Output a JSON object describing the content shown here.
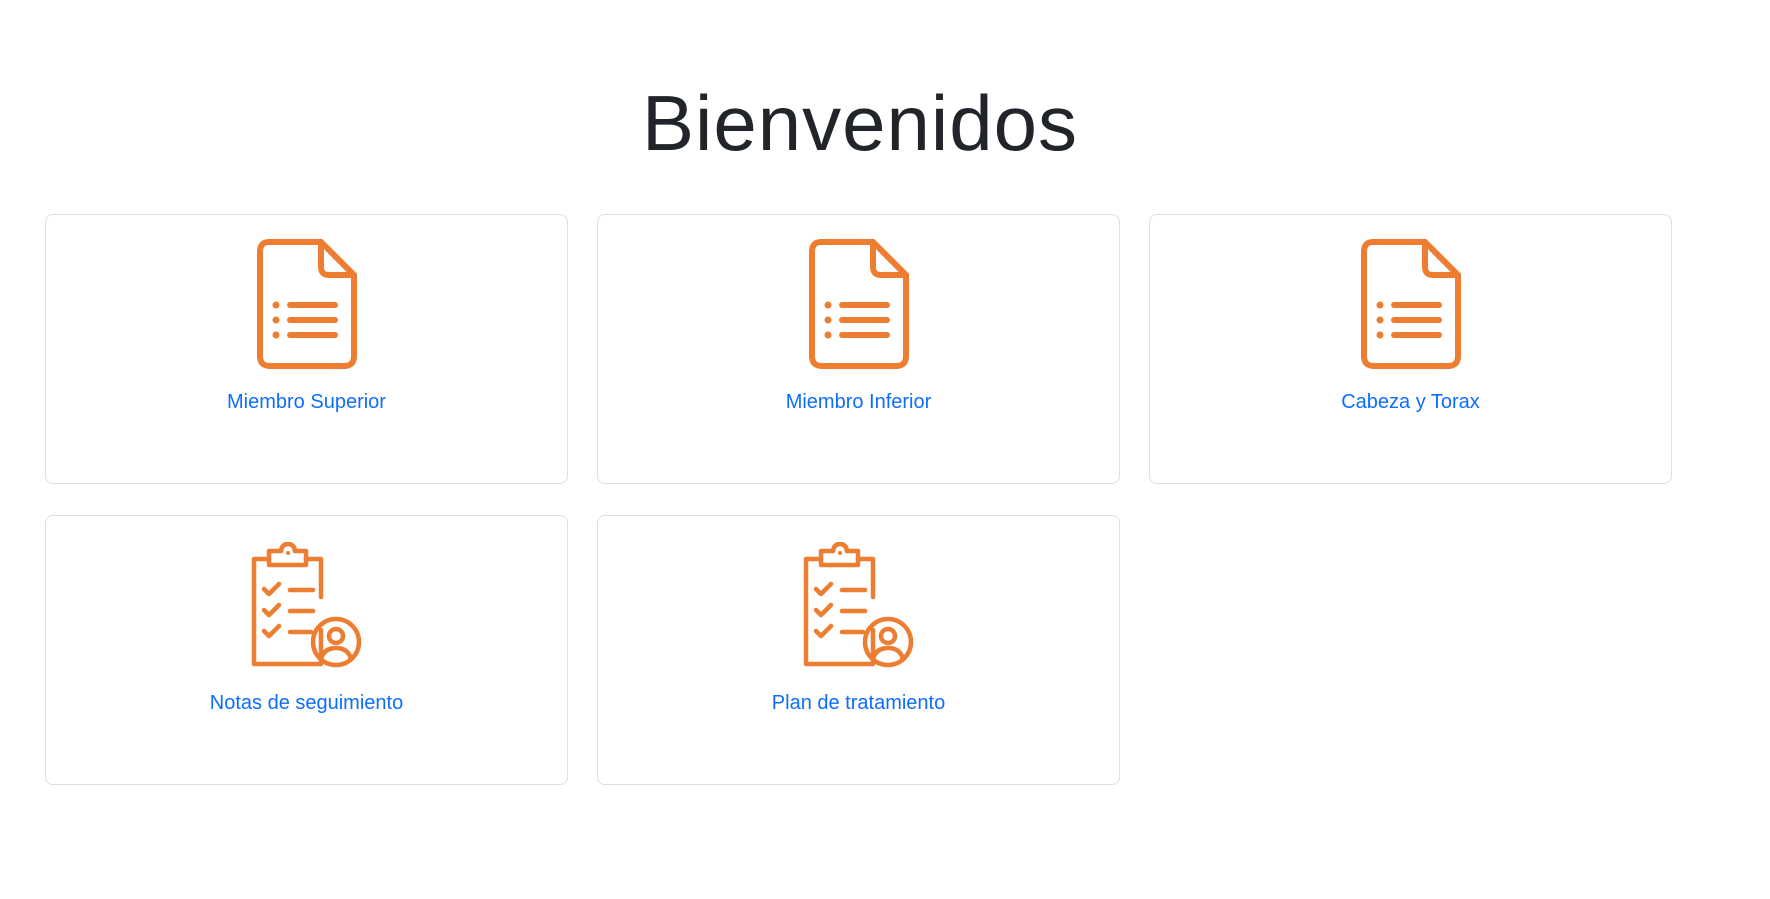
{
  "page": {
    "title": "Bienvenidos"
  },
  "theme": {
    "accent_icon_color": "#ED7D31",
    "link_color": "#0d6efd",
    "border_color": "#dcdfe3"
  },
  "cards": [
    {
      "label": "Miembro Superior",
      "icon": "document-list-icon"
    },
    {
      "label": "Miembro Inferior",
      "icon": "document-list-icon"
    },
    {
      "label": "Cabeza y Torax",
      "icon": "document-list-icon"
    },
    {
      "label": "Notas de seguimiento",
      "icon": "clipboard-checklist-user-icon"
    },
    {
      "label": "Plan de tratamiento",
      "icon": "clipboard-checklist-user-icon"
    }
  ]
}
